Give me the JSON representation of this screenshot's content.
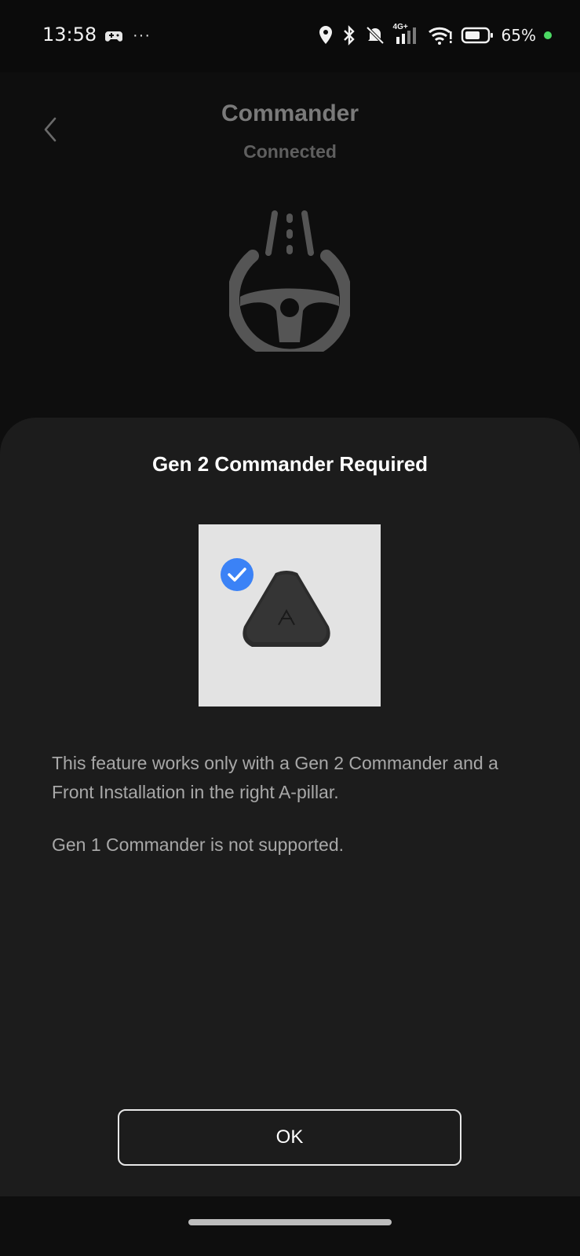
{
  "status_bar": {
    "time": "13:58",
    "more": "···",
    "network": "4G+",
    "battery_percent": "65%",
    "icons": [
      "game-controller-icon",
      "location-icon",
      "bluetooth-icon",
      "bell-muted-icon",
      "signal-icon",
      "wifi-icon",
      "battery-icon"
    ]
  },
  "header": {
    "title": "Commander",
    "subtitle": "Connected"
  },
  "modal": {
    "title": "Gen 2 Commander Required",
    "description": "This feature works only with a Gen 2 Commander and a Front Installation in the right A-pillar.",
    "note": "Gen 1 Commander is not supported.",
    "ok_label": "OK"
  },
  "colors": {
    "accent_check": "#3b82f6",
    "sheet_background": "#1c1c1c",
    "background": "#0e0e0e"
  }
}
